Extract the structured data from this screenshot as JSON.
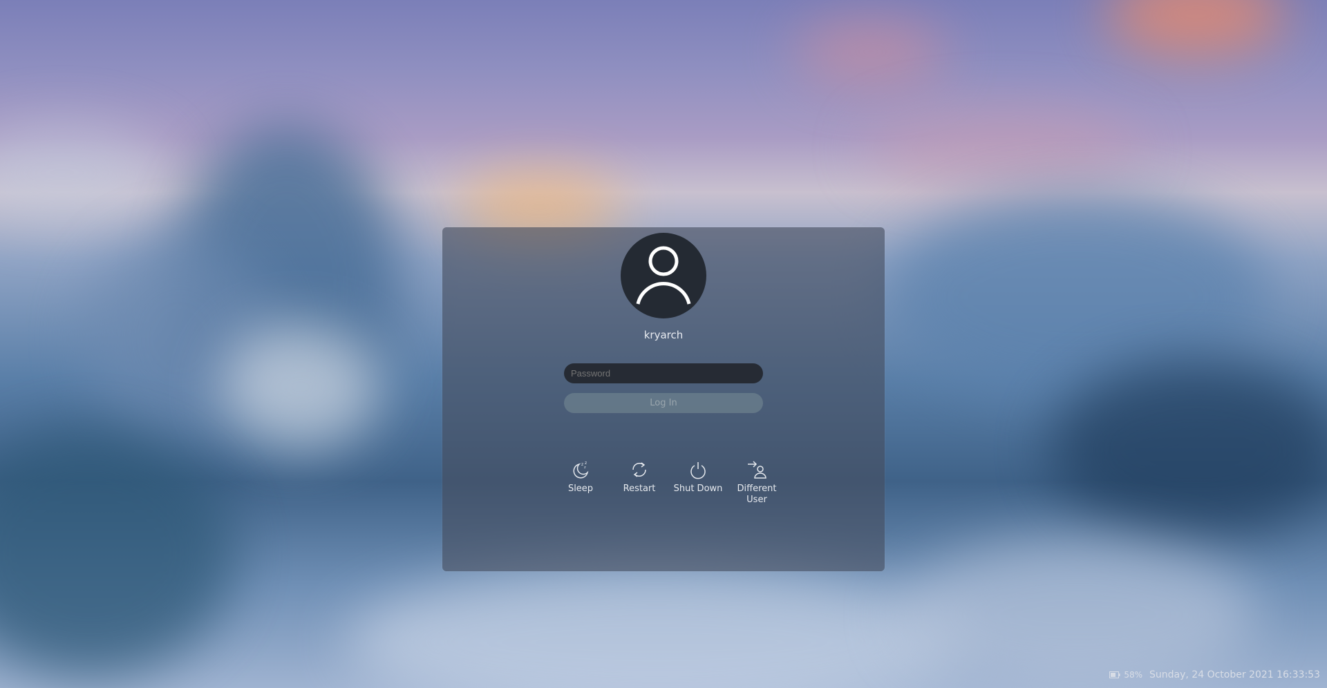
{
  "user": {
    "name": "kryarch"
  },
  "login_form": {
    "password_placeholder": "Password",
    "login_label": "Log In"
  },
  "actions": [
    {
      "label": "Sleep",
      "icon": "sleep-icon"
    },
    {
      "label": "Restart",
      "icon": "restart-icon"
    },
    {
      "label": "Shut Down",
      "icon": "power-icon"
    },
    {
      "label": "Different User",
      "icon": "switch-user-icon"
    }
  ],
  "status_bar": {
    "battery": "58%",
    "datetime": "Sunday, 24 October 2021 16:33:53"
  },
  "colors": {
    "card": "#464e60",
    "avatar_bg": "#242a33",
    "input_bg": "#262b34",
    "login_bg": "#788c96",
    "text": "#e9ecf1"
  }
}
